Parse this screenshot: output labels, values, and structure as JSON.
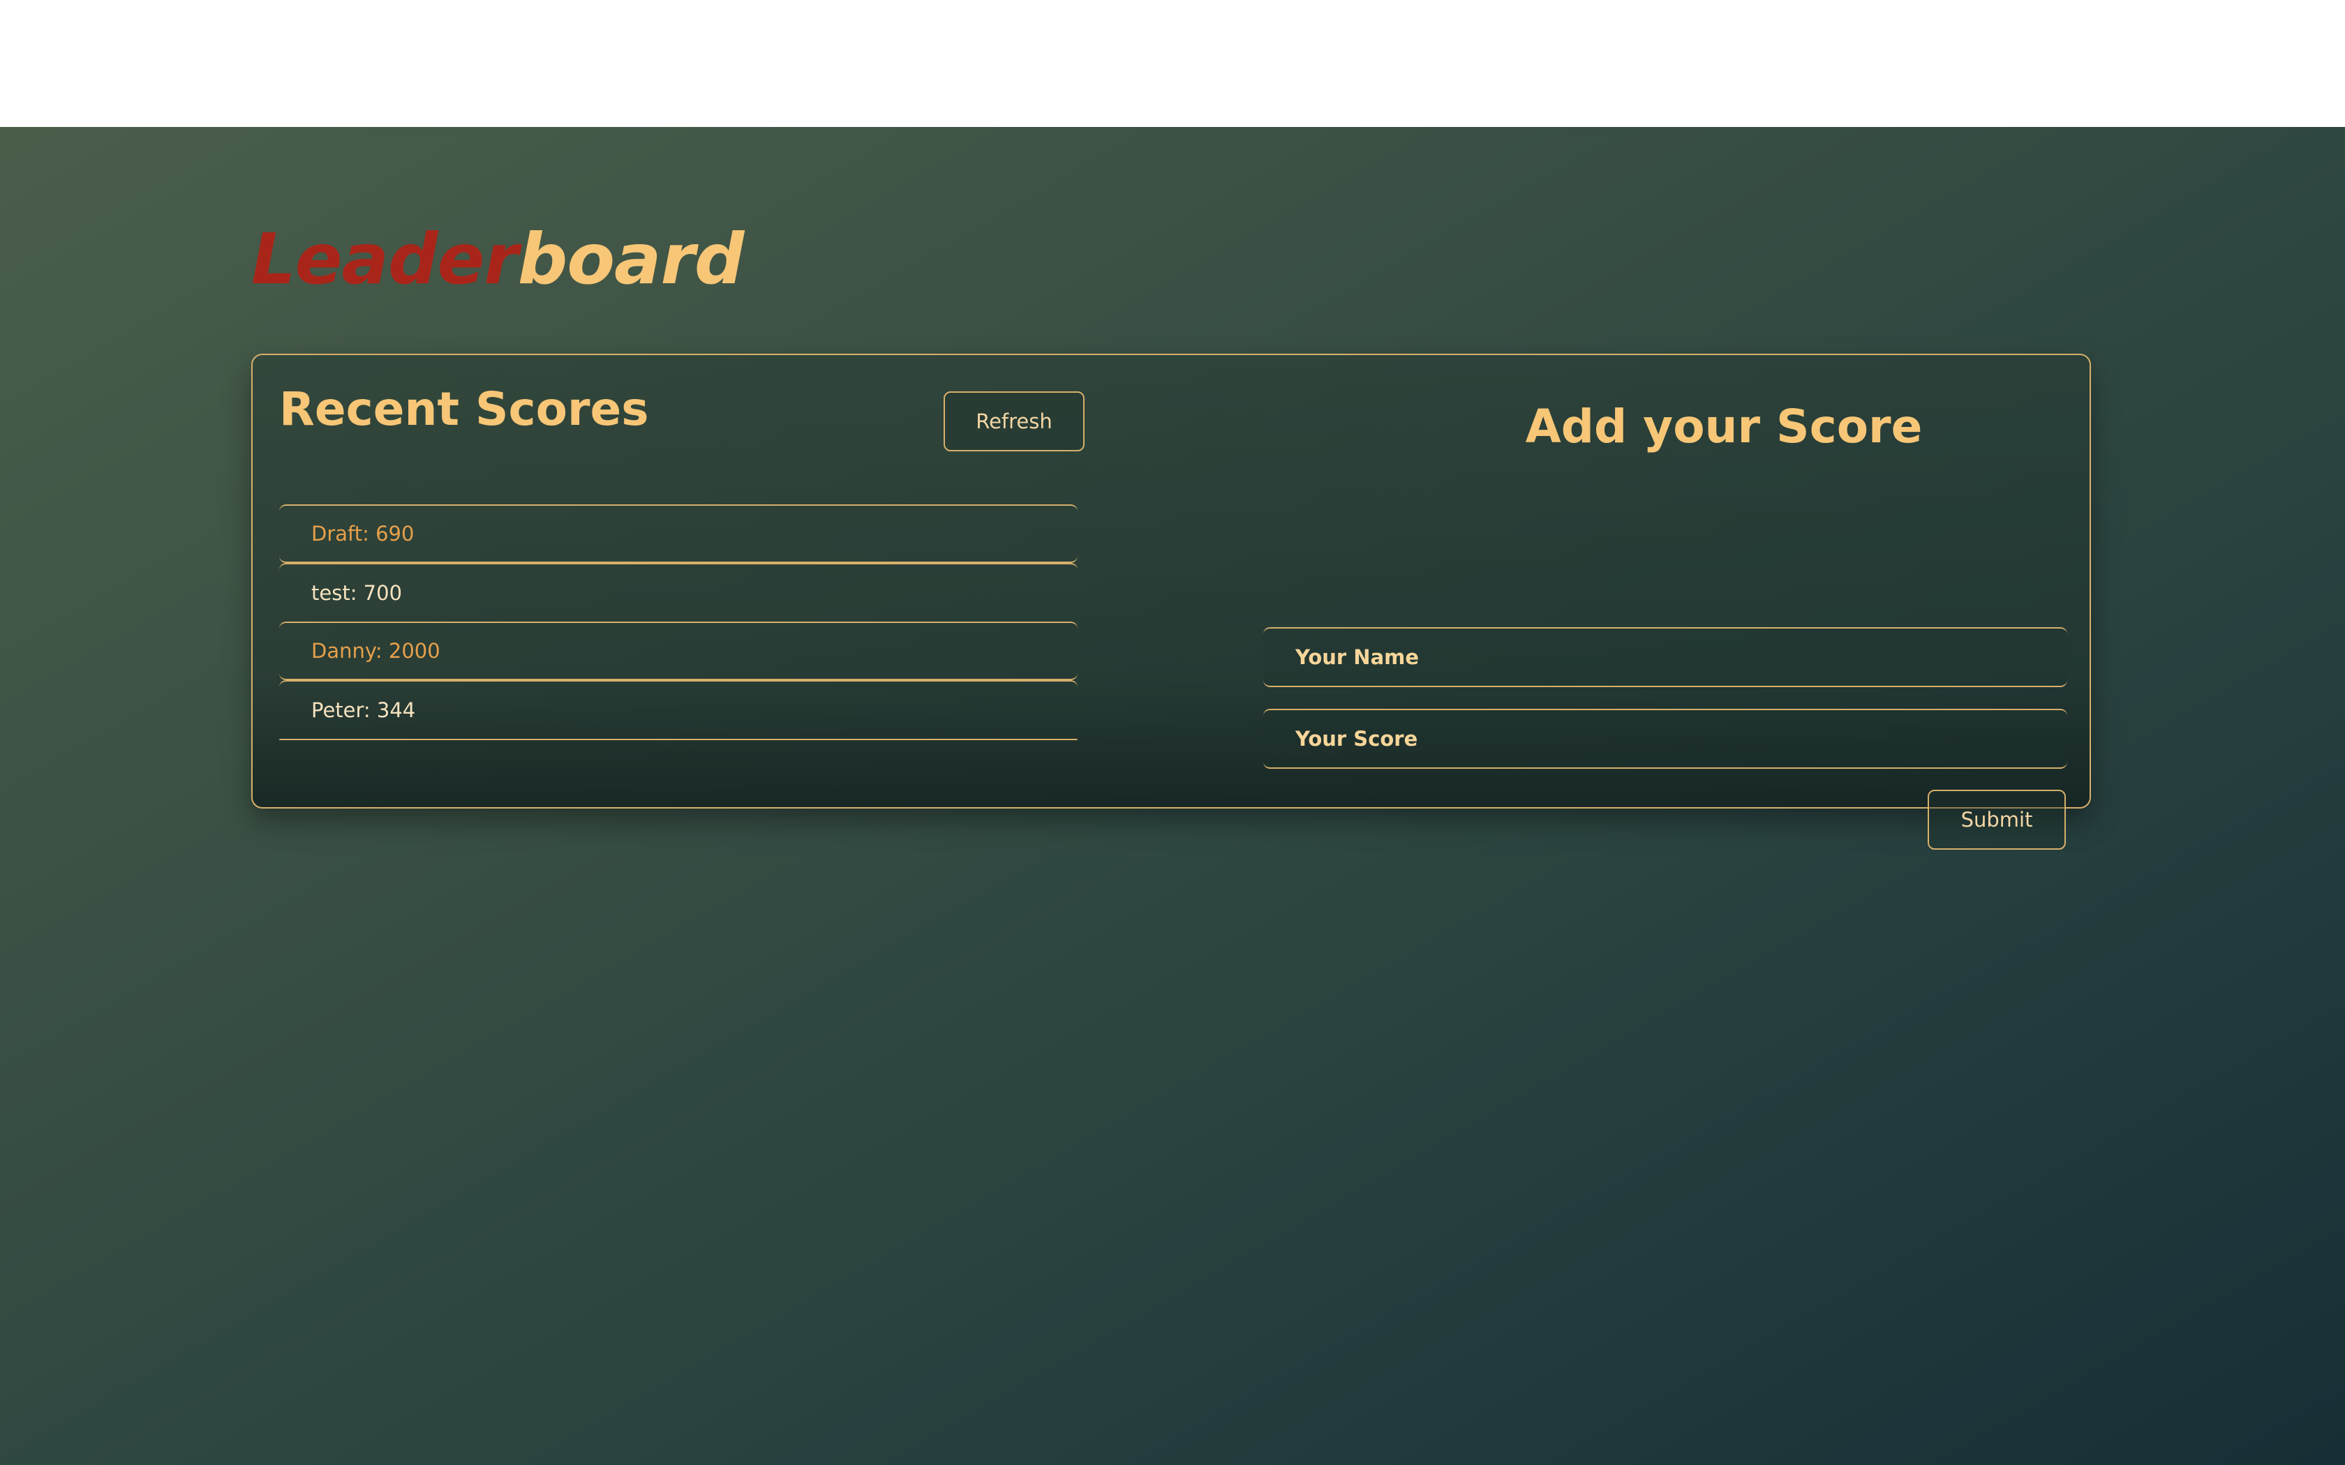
{
  "header": {
    "title_part1": "Leader",
    "title_part2": "board"
  },
  "recent": {
    "title": "Recent Scores",
    "refresh_label": "Refresh",
    "scores": [
      {
        "name": "Draft",
        "score": "690",
        "text": "Draft: 690"
      },
      {
        "name": "test",
        "score": "700",
        "text": "test: 700"
      },
      {
        "name": "Danny",
        "score": "2000",
        "text": "Danny: 2000"
      },
      {
        "name": "Peter",
        "score": "344",
        "text": "Peter: 344"
      }
    ]
  },
  "add": {
    "title": "Add your Score",
    "name_placeholder": "Your Name",
    "score_placeholder": "Your Score",
    "submit_label": "Submit"
  },
  "colors": {
    "accent_red": "#a9251a",
    "accent_gold": "#f7c677",
    "border_gold": "#d7b06b",
    "score_orange": "#e6a04a"
  }
}
